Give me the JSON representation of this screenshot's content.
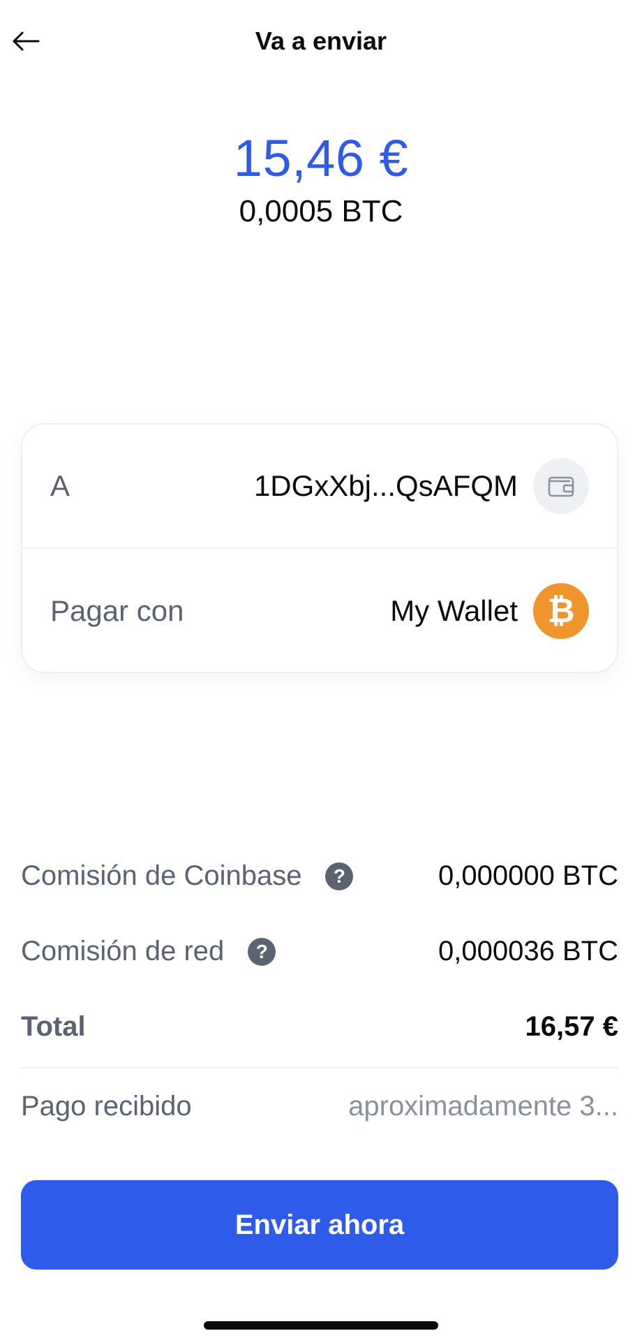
{
  "header": {
    "title": "Va a enviar",
    "back_icon": "arrow-left-icon"
  },
  "amount": {
    "fiat": "15,46 €",
    "crypto": "0,0005 BTC"
  },
  "recipient": {
    "label": "A",
    "value": "1DGxXbj...QsAFQM",
    "icon": "wallet-icon"
  },
  "payment": {
    "label": "Pagar con",
    "value": "My Wallet",
    "icon": "bitcoin-icon",
    "icon_glyph": "₿"
  },
  "fees": {
    "coinbase_label": "Comisión de Coinbase",
    "coinbase_value": "0,000000 BTC",
    "network_label": "Comisión de red",
    "network_value": "0,000036 BTC",
    "help_glyph": "?"
  },
  "total": {
    "label": "Total",
    "value": "16,57 €"
  },
  "receipt": {
    "label": "Pago recibido",
    "value": "aproximadamente 3..."
  },
  "actions": {
    "send_label": "Enviar ahora"
  },
  "colors": {
    "accent": "#2f5bea",
    "bitcoin": "#f0952d",
    "muted_text": "#5b6371"
  }
}
